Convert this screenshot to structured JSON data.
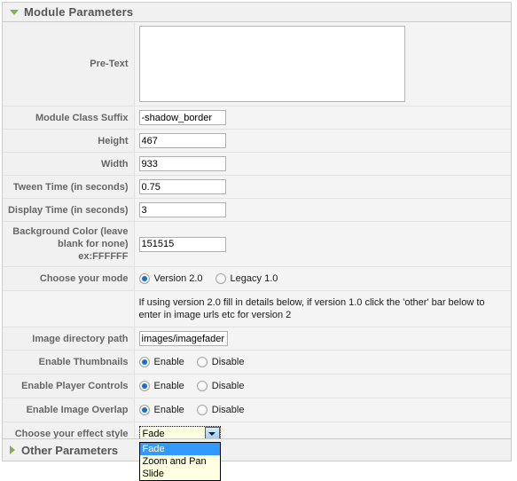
{
  "panel": {
    "header": {
      "title": "Module Parameters",
      "toggle_icon": "triangle-down-icon"
    },
    "rows": [
      {
        "label": "Pre-Text",
        "type": "textarea",
        "value": ""
      },
      {
        "label": "Module Class Suffix",
        "type": "text",
        "value": "-shadow_border"
      },
      {
        "label": "Height",
        "type": "text",
        "value": "467"
      },
      {
        "label": "Width",
        "type": "text",
        "value": "933"
      },
      {
        "label": "Tween Time (in seconds)",
        "type": "text",
        "value": "0.75"
      },
      {
        "label": "Display Time (in seconds)",
        "type": "text",
        "value": "3"
      },
      {
        "label": "Background Color (leave blank for none) ex:FFFFFF",
        "type": "text",
        "value": "151515"
      },
      {
        "label": "Choose your mode",
        "type": "radio",
        "options": [
          {
            "label": "Version 2.0",
            "checked": true
          },
          {
            "label": "Legacy 1.0",
            "checked": false
          }
        ]
      },
      {
        "label": "",
        "type": "help",
        "value": "If using version 2.0 fill in details below, if version 1.0 click the 'other' bar below to enter in image urls etc for version 2"
      },
      {
        "label": "Image directory path",
        "type": "text",
        "value": "images/imagefader"
      },
      {
        "label": "Enable Thumbnails",
        "type": "radio",
        "options": [
          {
            "label": "Enable",
            "checked": true
          },
          {
            "label": "Disable",
            "checked": false
          }
        ]
      },
      {
        "label": "Enable Player Controls",
        "type": "radio",
        "options": [
          {
            "label": "Enable",
            "checked": true
          },
          {
            "label": "Disable",
            "checked": false
          }
        ]
      },
      {
        "label": "Enable Image Overlap",
        "type": "radio",
        "options": [
          {
            "label": "Enable",
            "checked": true
          },
          {
            "label": "Disable",
            "checked": false
          }
        ]
      },
      {
        "label": "Choose your effect style",
        "type": "select",
        "value": "Fade",
        "expanded": true,
        "arrow_icon": "chevron-down-icon",
        "options": [
          {
            "label": "Fade",
            "selected": true
          },
          {
            "label": "Zoom and Pan",
            "selected": false
          },
          {
            "label": "Slide",
            "selected": false
          }
        ]
      }
    ]
  },
  "other_panel": {
    "title": "Other Parameters",
    "toggle_icon": "triangle-right-icon"
  },
  "colors": {
    "accent_green": "#7bb24a",
    "label_text": "#666666",
    "panel_bg": "#f4f4f4",
    "header_bg": "#f1f1f1",
    "border": "#cccccc",
    "radio_dot": "#1a6fc4",
    "select_bg": "#ffffe1",
    "option_highlight": "#3399ff"
  }
}
